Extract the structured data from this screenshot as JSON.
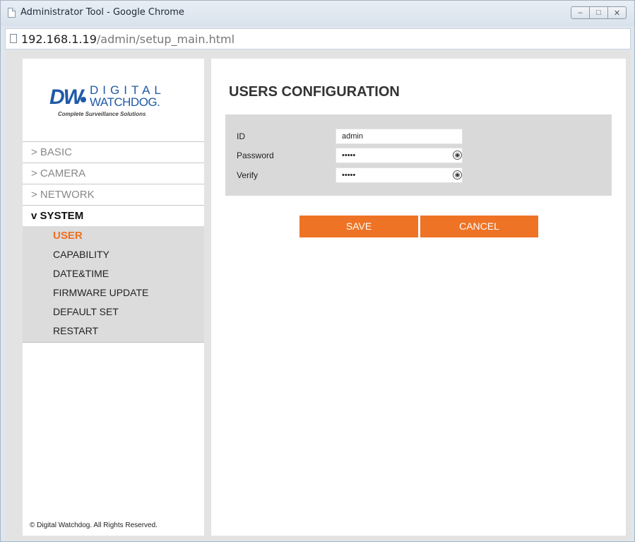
{
  "window": {
    "title": "Administrator Tool - Google Chrome",
    "address_host": "192.168.1.19",
    "address_path": "/admin/setup_main.html"
  },
  "logo": {
    "dw": "DW",
    "digital": "DIGITAL",
    "watchdog": "WATCHDOG.",
    "tagline": "Complete Surveillance Solutions"
  },
  "menu": {
    "items": [
      {
        "label": "> BASIC"
      },
      {
        "label": "> CAMERA"
      },
      {
        "label": "> NETWORK"
      },
      {
        "label": "v SYSTEM"
      }
    ],
    "submenu": [
      {
        "label": "USER"
      },
      {
        "label": "CAPABILITY"
      },
      {
        "label": "DATE&TIME"
      },
      {
        "label": "FIRMWARE UPDATE"
      },
      {
        "label": "DEFAULT SET"
      },
      {
        "label": "RESTART"
      }
    ]
  },
  "footer": "© Digital Watchdog. All Rights Reserved.",
  "main": {
    "title": "USERS CONFIGURATION",
    "fields": [
      {
        "label": "ID",
        "value": "admin"
      },
      {
        "label": "Password",
        "value": "•••••"
      },
      {
        "label": "Verify",
        "value": "•••••"
      }
    ],
    "save_label": "SAVE",
    "cancel_label": "CANCEL"
  },
  "colors": {
    "accent": "#ee7324",
    "active_menu": "#ef6f1f",
    "brand": "#1f5aa6"
  },
  "icons": [
    "page-icon",
    "minimize-icon",
    "maximize-icon",
    "close-icon",
    "eye-icon"
  ]
}
